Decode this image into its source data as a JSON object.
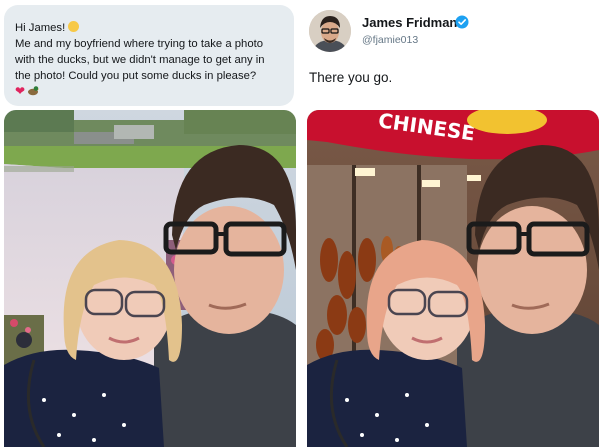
{
  "request": {
    "greeting": "Hi James!",
    "lines": [
      "Me and my boyfriend where trying to take a photo",
      "with the ducks, but we didn't manage to get any in",
      "the photo! Could you put some ducks in please?"
    ],
    "emoji_icons": [
      "waving-hand-icon",
      "red-heart-icon",
      "duck-icon"
    ]
  },
  "reply": {
    "author_name": "James Fridman",
    "handle": "@fjamie013",
    "text": "There you go.",
    "verified": true
  },
  "photos": {
    "edited_sign_text": "CHINESE"
  },
  "colors": {
    "bubble_bg": "#e6ecf0",
    "verified_blue": "#1da1f2",
    "sign_red": "#c8102e",
    "shirt_navy": "#1b2340"
  }
}
